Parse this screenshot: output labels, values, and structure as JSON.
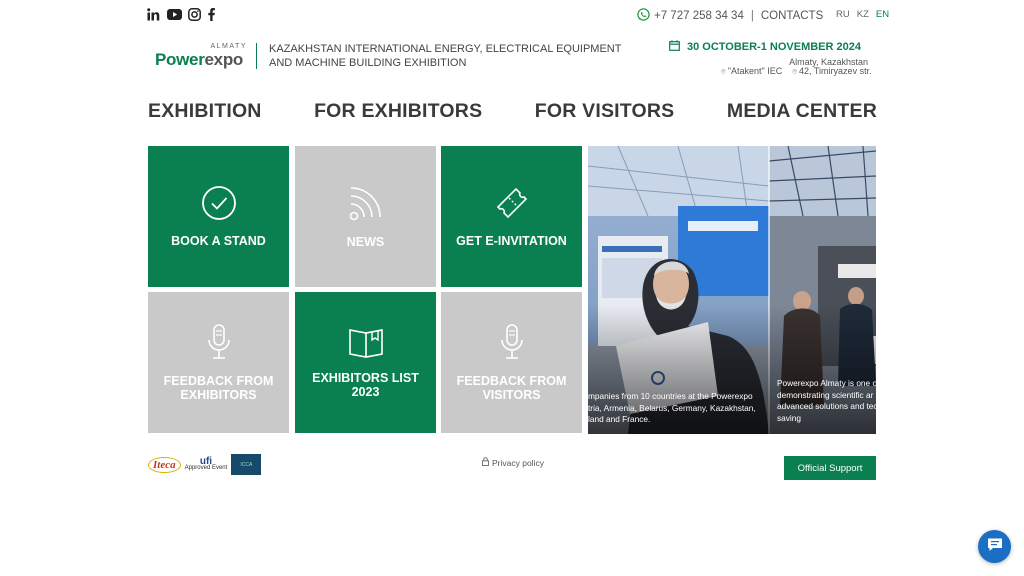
{
  "top": {
    "social": [
      "linkedin-icon",
      "youtube-icon",
      "instagram-icon",
      "facebook-icon"
    ],
    "phone": "+7 727 258 34 34",
    "separator": "|",
    "contacts": "CONTACTS",
    "languages": [
      "RU",
      "KZ",
      "EN"
    ],
    "active_language": "EN"
  },
  "header": {
    "logo_top": "ALMATY",
    "logo_name_a": "Power",
    "logo_name_b": "expo",
    "title": "KAZAKHSTAN INTERNATIONAL ENERGY, ELECTRICAL EQUIPMENT AND MACHINE BUILDING EXHIBITION",
    "dates": "30 OCTOBER-1 NOVEMBER 2024",
    "city": "Almaty, Kazakhstan",
    "venue": "\"Atakent\" IEC",
    "address": "42, Timiryazev str."
  },
  "nav": [
    "EXHIBITION",
    "FOR EXHIBITORS",
    "FOR VISITORS",
    "MEDIA CENTER"
  ],
  "tiles": [
    {
      "label": "BOOK A STAND",
      "icon": "check-circle-icon"
    },
    {
      "label": "NEWS",
      "icon": "rss-icon"
    },
    {
      "label": "GET E-INVITATION",
      "icon": "ticket-icon"
    },
    {
      "label": "FEEDBACK FROM EXHIBITORS",
      "icon": "microphone-icon"
    },
    {
      "label": "EXHIBITORS LIST 2023",
      "icon": "book-icon"
    },
    {
      "label": "FEEDBACK FROM VISITORS",
      "icon": "microphone-icon"
    }
  ],
  "slider": {
    "caption1": "mpanies from 10 countries at the Powerexpo tria, Armenia, Belarus, Germany, Kazakhstan, land and France.",
    "caption2": "Powerexpo Almaty is one o demonstrating scientific ar advanced solutions and tec saving"
  },
  "footer": {
    "partner1": "Iteca",
    "partner2_top": "ufi",
    "partner2_bottom": "Approved Event",
    "partner3": "ICCA",
    "privacy": "Privacy policy",
    "support": "Official Support"
  },
  "colors": {
    "brand_green": "#0a8050",
    "tile_gray": "#c9c9c9",
    "chat_blue": "#1a6fc4"
  }
}
